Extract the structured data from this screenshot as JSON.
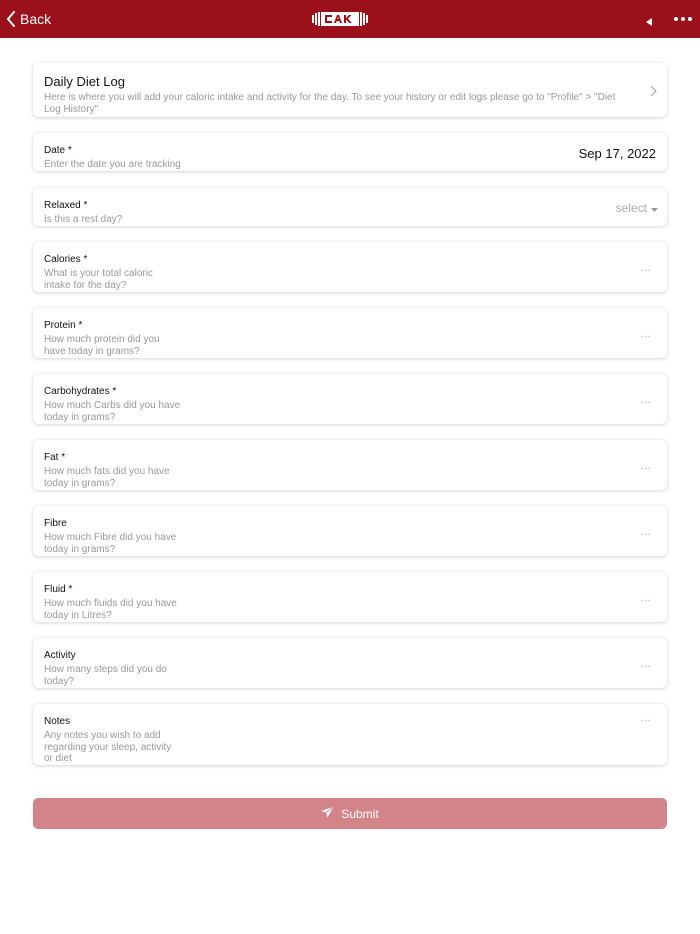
{
  "header": {
    "back_label": "Back",
    "brand_color": "#9c101b"
  },
  "intro": {
    "title": "Daily Diet Log",
    "description": "Here is where you will add your caloric intake and activity for the day. To see your history or edit logs please go to \"Profile\" > \"Diet Log History\""
  },
  "date_field": {
    "label": "Date *",
    "hint": "Enter the date you are tracking",
    "value": "Sep 17, 2022"
  },
  "relaxed_field": {
    "label": "Relaxed *",
    "hint": "Is this a rest day?",
    "value": "select"
  },
  "fields": [
    {
      "label": "Calories *",
      "hint_lines": [
        "What is your total caloric",
        "intake for the day?"
      ],
      "value": "..."
    },
    {
      "label": "Protein *",
      "hint_lines": [
        "How much protein did you",
        "have today in grams?"
      ],
      "value": "..."
    },
    {
      "label": "Carbohydrates *",
      "hint_lines": [
        "How much Carbs did you have",
        "today in grams?"
      ],
      "value": "..."
    },
    {
      "label": "Fat *",
      "hint_lines": [
        "How much fats did you have",
        "today in grams?"
      ],
      "value": "..."
    },
    {
      "label": "Fibre",
      "hint_lines": [
        "How much Fibre did you have",
        "today in grams?"
      ],
      "value": "..."
    },
    {
      "label": "Fluid *",
      "hint_lines": [
        "How much fluids did you have",
        "today in Litres?"
      ],
      "value": "..."
    },
    {
      "label": "Activity",
      "hint_lines": [
        "How many steps did you do",
        "today?"
      ],
      "value": "..."
    },
    {
      "label": "Notes",
      "hint_lines": [
        "Any notes you wish to add",
        "regarding your sleep, activity",
        "or diet"
      ],
      "value": "..."
    }
  ],
  "submit": {
    "label": "Submit",
    "color": "#d28488"
  }
}
